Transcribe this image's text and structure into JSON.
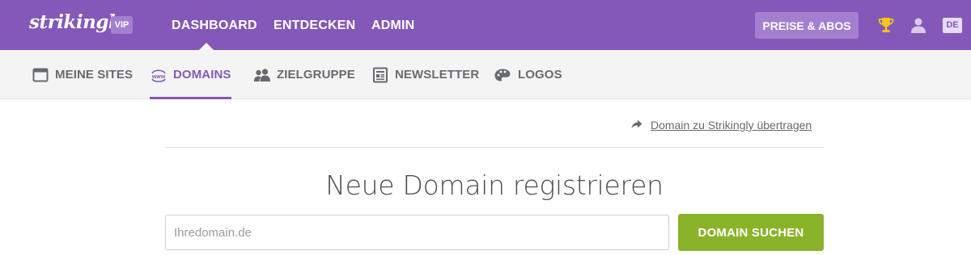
{
  "brand": {
    "name": "strikingly",
    "badge": "VIP"
  },
  "main_nav": {
    "items": [
      {
        "label": "DASHBOARD"
      },
      {
        "label": "ENTDECKEN"
      },
      {
        "label": "ADMIN"
      }
    ],
    "active": "DASHBOARD"
  },
  "header_actions": {
    "pricing_label": "PREISE & ABOS",
    "trophy_icon": "trophy-icon",
    "user_icon": "user-icon",
    "language": "DE"
  },
  "sub_nav": {
    "items": [
      {
        "label": "MEINE SITES",
        "icon": "browser-window-icon"
      },
      {
        "label": "DOMAINS",
        "icon": "www-icon"
      },
      {
        "label": "ZIELGRUPPE",
        "icon": "users-icon"
      },
      {
        "label": "NEWSLETTER",
        "icon": "newsletter-icon"
      },
      {
        "label": "LOGOS",
        "icon": "palette-icon"
      }
    ],
    "active": "DOMAINS"
  },
  "content": {
    "transfer_link": "Domain zu Strikingly übertragen",
    "heading": "Neue Domain registrieren",
    "domain_input": {
      "placeholder": "Ihredomain.de",
      "value": ""
    },
    "search_button": "DOMAIN SUCHEN"
  },
  "colors": {
    "brand_purple": "#8458b9",
    "badge_purple": "#a47fd0",
    "search_green": "#8ab32a",
    "subnav_bg": "#f4f4f4"
  }
}
